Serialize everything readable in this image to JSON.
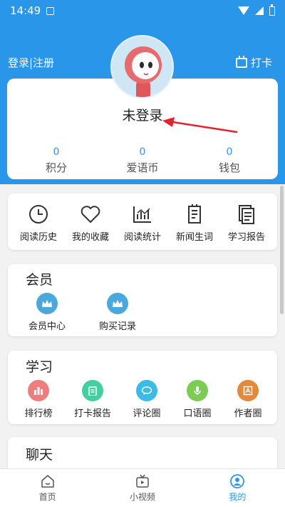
{
  "status_bar": {
    "time": "14:49"
  },
  "header": {
    "login_label": "登录|注册",
    "checkin_label": "打卡",
    "username": "未登录"
  },
  "stats": [
    {
      "value": "0",
      "label": "积分"
    },
    {
      "value": "0",
      "label": "爱语币"
    },
    {
      "value": "0",
      "label": "钱包"
    }
  ],
  "quick_actions": [
    {
      "label": "阅读历史",
      "icon": "clock-icon"
    },
    {
      "label": "我的收藏",
      "icon": "heart-icon"
    },
    {
      "label": "阅读统计",
      "icon": "chart-icon"
    },
    {
      "label": "新闻生词",
      "icon": "note-icon"
    },
    {
      "label": "学习报告",
      "icon": "document-icon"
    }
  ],
  "member": {
    "title": "会员",
    "items": [
      {
        "label": "会员中心",
        "icon": "crown-icon"
      },
      {
        "label": "购买记录",
        "icon": "crown-icon"
      }
    ]
  },
  "study": {
    "title": "学习",
    "items": [
      {
        "label": "排行榜",
        "icon": "ranking-icon",
        "color": "#ee7e7e"
      },
      {
        "label": "打卡报告",
        "icon": "clipboard-icon",
        "color": "#44cfa2"
      },
      {
        "label": "评论圈",
        "icon": "comment-icon",
        "color": "#3bbbe6"
      },
      {
        "label": "口语圈",
        "icon": "microphone-icon",
        "color": "#7ccb55"
      },
      {
        "label": "作者圈",
        "icon": "author-icon",
        "color": "#e2893b"
      }
    ]
  },
  "chat": {
    "title": "聊天"
  },
  "tabbar": {
    "items": [
      {
        "label": "首页",
        "icon": "home-icon"
      },
      {
        "label": "小视频",
        "icon": "video-icon"
      },
      {
        "label": "我的",
        "icon": "profile-icon",
        "active": true
      }
    ]
  },
  "colors": {
    "accent": "#2a96ea",
    "background": "#f2f2f2",
    "arrow": "#e0242b"
  }
}
